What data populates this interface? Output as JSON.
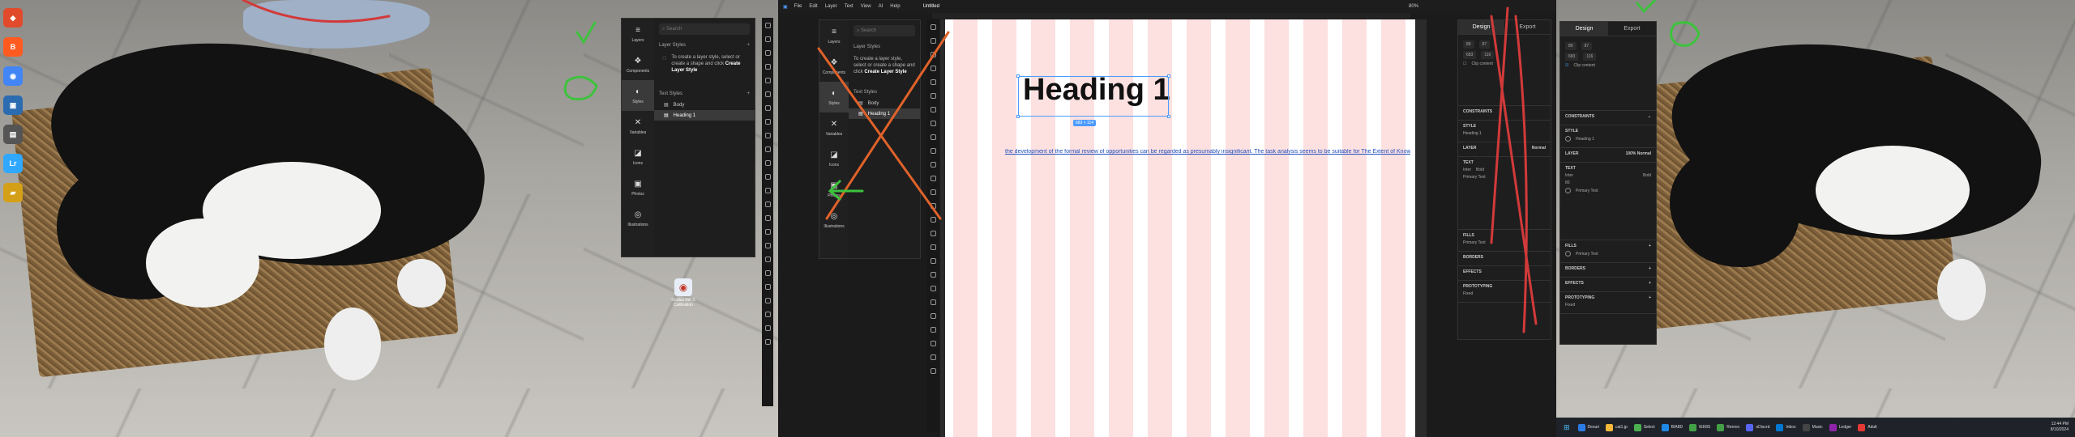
{
  "left_monitor": {
    "desktop_icons": [
      {
        "label": "",
        "color": "#e14b2c",
        "glyph": "◆"
      },
      {
        "label": "",
        "color": "#ff5a1f",
        "glyph": "B"
      },
      {
        "label": "",
        "color": "#4285f4",
        "glyph": "◉"
      },
      {
        "label": "",
        "color": "#2b6cb0",
        "glyph": "▣"
      },
      {
        "label": "",
        "color": "#555555",
        "glyph": "▤"
      },
      {
        "label": "",
        "color": "#31a8ff",
        "glyph": "Lr"
      },
      {
        "label": "",
        "color": "#d4a017",
        "glyph": "▰"
      }
    ],
    "shortcut_label": "Oculus Rift S Calibration",
    "layers_panel": {
      "nav": [
        {
          "label": "Layers",
          "icon": "layers-icon",
          "glyph": "≡"
        },
        {
          "label": "Components",
          "icon": "components-icon",
          "glyph": "❖"
        },
        {
          "label": "Styles",
          "icon": "styles-icon",
          "glyph": "◐"
        },
        {
          "label": "Variables",
          "icon": "variables-icon",
          "glyph": "✕"
        },
        {
          "label": "Icons",
          "icon": "icons-icon",
          "glyph": "◪"
        },
        {
          "label": "Photos",
          "icon": "photos-icon",
          "glyph": "▣"
        },
        {
          "label": "Illustrations",
          "icon": "illustrations-icon",
          "glyph": "◎"
        }
      ],
      "search_placeholder": "Search",
      "section_layer_styles": "Layer Styles",
      "hint_text": "To create a layer style, select or create a shape and click",
      "hint_action": "Create Layer Style",
      "section_text_styles": "Text Styles",
      "text_styles": [
        "Body",
        "Heading 1"
      ]
    }
  },
  "middle_monitor": {
    "menu": [
      "File",
      "Edit",
      "Layer",
      "Text",
      "View",
      "AI",
      "Help"
    ],
    "doc_title": "Untitled",
    "zoom": "80%",
    "heading_text": "Heading 1",
    "dimension_tag": "683 × 114",
    "body_text": "the development of the formal review of opportunities can be regarded as presumably insignificant. The task analysis seems to be suitable for The Extent of Known Own",
    "design_tab": "Design",
    "export_tab": "Export"
  },
  "right_monitor": {
    "design_tab": "Design",
    "export_tab": "Export",
    "position": {
      "x": "89",
      "y": "87",
      "w": "683",
      "h": "116"
    },
    "clip_content": "Clip content",
    "sections": {
      "constraints": "CONSTRAINTS",
      "style": "STYLE",
      "style_value": "Heading 1",
      "layer": "LAYER",
      "layer_opacity": "100%",
      "layer_blend": "Normal",
      "text": "TEXT",
      "font": "Inter",
      "weight": "Bold",
      "size": "80",
      "primary_text": "Primary Text",
      "fills": "FILLS",
      "fill_value": "Primary Text",
      "borders": "BORDERS",
      "effects": "EFFECTS",
      "prototyping": "PROTOTYPING",
      "proto_value": "Fixed"
    },
    "taskbar": [
      {
        "label": "Desuri",
        "color": "#2c7be5"
      },
      {
        "label": "cat1.jp",
        "color": "#f6b93b"
      },
      {
        "label": "Select",
        "color": "#4caf50"
      },
      {
        "label": "BIA8D",
        "color": "#1e88e5"
      },
      {
        "label": "IEK8S",
        "color": "#43a047"
      },
      {
        "label": "Renrec",
        "color": "#43a047"
      },
      {
        "label": "oDiscrd",
        "color": "#5865f2"
      },
      {
        "label": "Inbox",
        "color": "#0078d4"
      },
      {
        "label": "Music",
        "color": "#444444"
      },
      {
        "label": "Ledger",
        "color": "#8e24aa"
      },
      {
        "label": "Adult",
        "color": "#e53935"
      }
    ],
    "clock_time": "12:44 PM",
    "clock_date": "8/10/2024"
  },
  "colors": {
    "accent": "#4c9bff",
    "annotation_red": "#d23a3a",
    "annotation_green": "#3ec23e",
    "annotation_orange": "#e0622a"
  }
}
